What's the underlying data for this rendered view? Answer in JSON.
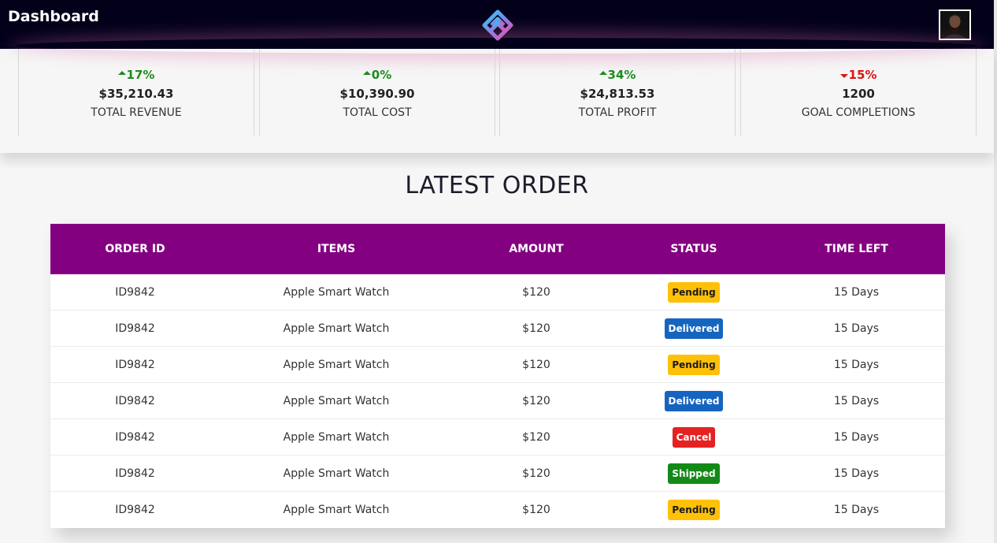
{
  "header": {
    "title": "Dashboard",
    "logo_icon": "brand-logo-icon",
    "avatar_icon": "user-avatar-icon"
  },
  "stats": [
    {
      "change": "17%",
      "direction": "up",
      "value": "$35,210.43",
      "label": "TOTAL REVENUE"
    },
    {
      "change": "0%",
      "direction": "up",
      "value": "$10,390.90",
      "label": "TOTAL COST"
    },
    {
      "change": "34%",
      "direction": "up",
      "value": "$24,813.53",
      "label": "TOTAL PROFIT"
    },
    {
      "change": "15%",
      "direction": "down",
      "value": "1200",
      "label": "GOAL COMPLETIONS"
    }
  ],
  "orders": {
    "title": "LATEST ORDER",
    "columns": [
      "ORDER ID",
      "ITEMS",
      "AMOUNT",
      "STATUS",
      "TIME LEFT"
    ],
    "rows": [
      {
        "id": "ID9842",
        "item": "Apple Smart Watch",
        "amount": "$120",
        "status": "Pending",
        "time_left": "15 Days"
      },
      {
        "id": "ID9842",
        "item": "Apple Smart Watch",
        "amount": "$120",
        "status": "Delivered",
        "time_left": "15 Days"
      },
      {
        "id": "ID9842",
        "item": "Apple Smart Watch",
        "amount": "$120",
        "status": "Pending",
        "time_left": "15 Days"
      },
      {
        "id": "ID9842",
        "item": "Apple Smart Watch",
        "amount": "$120",
        "status": "Delivered",
        "time_left": "15 Days"
      },
      {
        "id": "ID9842",
        "item": "Apple Smart Watch",
        "amount": "$120",
        "status": "Cancel",
        "time_left": "15 Days"
      },
      {
        "id": "ID9842",
        "item": "Apple Smart Watch",
        "amount": "$120",
        "status": "Shipped",
        "time_left": "15 Days"
      },
      {
        "id": "ID9842",
        "item": "Apple Smart Watch",
        "amount": "$120",
        "status": "Pending",
        "time_left": "15 Days"
      }
    ]
  },
  "colors": {
    "header_bg": "#03001a",
    "table_header_bg": "#830080",
    "up": "#1c8c1c",
    "down": "#e01212",
    "pending": "#ffc107",
    "delivered": "#1565c0",
    "cancel": "#e52222",
    "shipped": "#138a17"
  }
}
